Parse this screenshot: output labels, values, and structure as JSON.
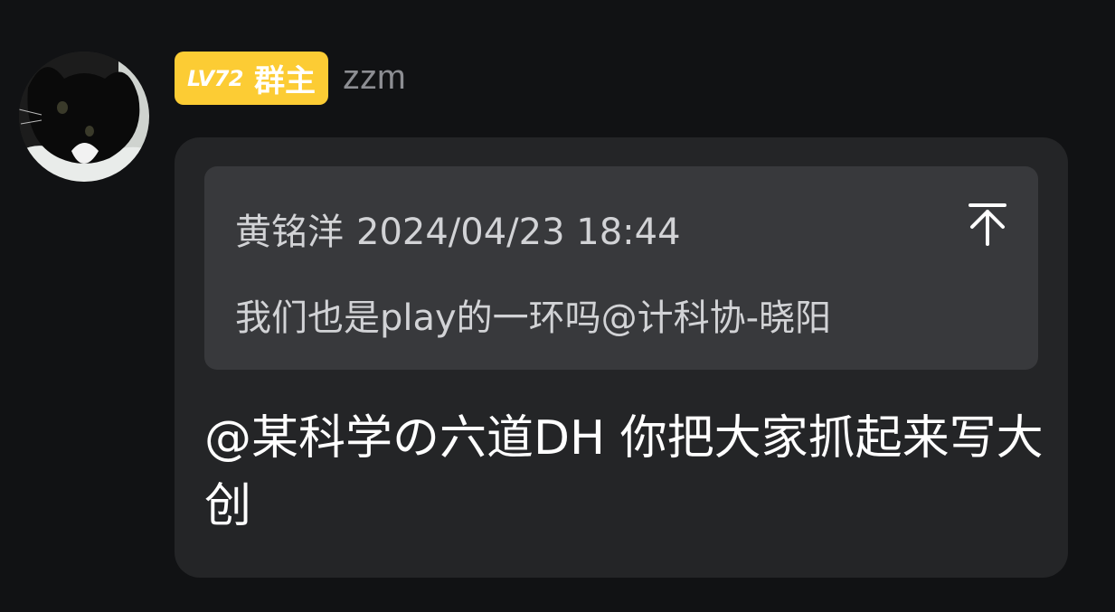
{
  "sender": {
    "avatar_icon": "cat-avatar",
    "badge": {
      "level": "LV72",
      "role": "群主",
      "color": "#fccc34"
    },
    "username": "zzm"
  },
  "message": {
    "quote": {
      "author": "黄铭洋",
      "timestamp": "2024/04/23 18:44",
      "text": "我们也是play的一环吗@计科协-晓阳",
      "jump_icon": "arrow-up-to-top-icon"
    },
    "text": "@某科学の六道DH 你把大家抓起来写大创"
  },
  "colors": {
    "background": "#111214",
    "bubble": "#242527",
    "quote_background": "#38393c",
    "username": "#8d8e93"
  }
}
